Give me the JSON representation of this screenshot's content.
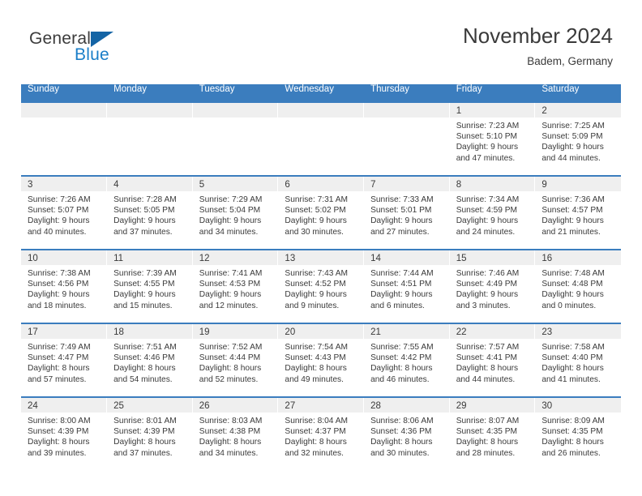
{
  "brand": {
    "name_part1": "General",
    "name_part2": "Blue",
    "accent_color": "#1a7ec8",
    "triangle_color": "#1464a5"
  },
  "header": {
    "month_title": "November 2024",
    "location": "Badem, Germany"
  },
  "theme": {
    "header_blue": "#3b7dbe",
    "day_head_gray": "#efefef",
    "text_color": "#3a3a3a"
  },
  "calendar": {
    "weekday_headers": [
      "Sunday",
      "Monday",
      "Tuesday",
      "Wednesday",
      "Thursday",
      "Friday",
      "Saturday"
    ],
    "weeks": [
      [
        {
          "day": "",
          "lines": []
        },
        {
          "day": "",
          "lines": []
        },
        {
          "day": "",
          "lines": []
        },
        {
          "day": "",
          "lines": []
        },
        {
          "day": "",
          "lines": []
        },
        {
          "day": "1",
          "lines": [
            "Sunrise: 7:23 AM",
            "Sunset: 5:10 PM",
            "Daylight: 9 hours",
            "and 47 minutes."
          ]
        },
        {
          "day": "2",
          "lines": [
            "Sunrise: 7:25 AM",
            "Sunset: 5:09 PM",
            "Daylight: 9 hours",
            "and 44 minutes."
          ]
        }
      ],
      [
        {
          "day": "3",
          "lines": [
            "Sunrise: 7:26 AM",
            "Sunset: 5:07 PM",
            "Daylight: 9 hours",
            "and 40 minutes."
          ]
        },
        {
          "day": "4",
          "lines": [
            "Sunrise: 7:28 AM",
            "Sunset: 5:05 PM",
            "Daylight: 9 hours",
            "and 37 minutes."
          ]
        },
        {
          "day": "5",
          "lines": [
            "Sunrise: 7:29 AM",
            "Sunset: 5:04 PM",
            "Daylight: 9 hours",
            "and 34 minutes."
          ]
        },
        {
          "day": "6",
          "lines": [
            "Sunrise: 7:31 AM",
            "Sunset: 5:02 PM",
            "Daylight: 9 hours",
            "and 30 minutes."
          ]
        },
        {
          "day": "7",
          "lines": [
            "Sunrise: 7:33 AM",
            "Sunset: 5:01 PM",
            "Daylight: 9 hours",
            "and 27 minutes."
          ]
        },
        {
          "day": "8",
          "lines": [
            "Sunrise: 7:34 AM",
            "Sunset: 4:59 PM",
            "Daylight: 9 hours",
            "and 24 minutes."
          ]
        },
        {
          "day": "9",
          "lines": [
            "Sunrise: 7:36 AM",
            "Sunset: 4:57 PM",
            "Daylight: 9 hours",
            "and 21 minutes."
          ]
        }
      ],
      [
        {
          "day": "10",
          "lines": [
            "Sunrise: 7:38 AM",
            "Sunset: 4:56 PM",
            "Daylight: 9 hours",
            "and 18 minutes."
          ]
        },
        {
          "day": "11",
          "lines": [
            "Sunrise: 7:39 AM",
            "Sunset: 4:55 PM",
            "Daylight: 9 hours",
            "and 15 minutes."
          ]
        },
        {
          "day": "12",
          "lines": [
            "Sunrise: 7:41 AM",
            "Sunset: 4:53 PM",
            "Daylight: 9 hours",
            "and 12 minutes."
          ]
        },
        {
          "day": "13",
          "lines": [
            "Sunrise: 7:43 AM",
            "Sunset: 4:52 PM",
            "Daylight: 9 hours",
            "and 9 minutes."
          ]
        },
        {
          "day": "14",
          "lines": [
            "Sunrise: 7:44 AM",
            "Sunset: 4:51 PM",
            "Daylight: 9 hours",
            "and 6 minutes."
          ]
        },
        {
          "day": "15",
          "lines": [
            "Sunrise: 7:46 AM",
            "Sunset: 4:49 PM",
            "Daylight: 9 hours",
            "and 3 minutes."
          ]
        },
        {
          "day": "16",
          "lines": [
            "Sunrise: 7:48 AM",
            "Sunset: 4:48 PM",
            "Daylight: 9 hours",
            "and 0 minutes."
          ]
        }
      ],
      [
        {
          "day": "17",
          "lines": [
            "Sunrise: 7:49 AM",
            "Sunset: 4:47 PM",
            "Daylight: 8 hours",
            "and 57 minutes."
          ]
        },
        {
          "day": "18",
          "lines": [
            "Sunrise: 7:51 AM",
            "Sunset: 4:46 PM",
            "Daylight: 8 hours",
            "and 54 minutes."
          ]
        },
        {
          "day": "19",
          "lines": [
            "Sunrise: 7:52 AM",
            "Sunset: 4:44 PM",
            "Daylight: 8 hours",
            "and 52 minutes."
          ]
        },
        {
          "day": "20",
          "lines": [
            "Sunrise: 7:54 AM",
            "Sunset: 4:43 PM",
            "Daylight: 8 hours",
            "and 49 minutes."
          ]
        },
        {
          "day": "21",
          "lines": [
            "Sunrise: 7:55 AM",
            "Sunset: 4:42 PM",
            "Daylight: 8 hours",
            "and 46 minutes."
          ]
        },
        {
          "day": "22",
          "lines": [
            "Sunrise: 7:57 AM",
            "Sunset: 4:41 PM",
            "Daylight: 8 hours",
            "and 44 minutes."
          ]
        },
        {
          "day": "23",
          "lines": [
            "Sunrise: 7:58 AM",
            "Sunset: 4:40 PM",
            "Daylight: 8 hours",
            "and 41 minutes."
          ]
        }
      ],
      [
        {
          "day": "24",
          "lines": [
            "Sunrise: 8:00 AM",
            "Sunset: 4:39 PM",
            "Daylight: 8 hours",
            "and 39 minutes."
          ]
        },
        {
          "day": "25",
          "lines": [
            "Sunrise: 8:01 AM",
            "Sunset: 4:39 PM",
            "Daylight: 8 hours",
            "and 37 minutes."
          ]
        },
        {
          "day": "26",
          "lines": [
            "Sunrise: 8:03 AM",
            "Sunset: 4:38 PM",
            "Daylight: 8 hours",
            "and 34 minutes."
          ]
        },
        {
          "day": "27",
          "lines": [
            "Sunrise: 8:04 AM",
            "Sunset: 4:37 PM",
            "Daylight: 8 hours",
            "and 32 minutes."
          ]
        },
        {
          "day": "28",
          "lines": [
            "Sunrise: 8:06 AM",
            "Sunset: 4:36 PM",
            "Daylight: 8 hours",
            "and 30 minutes."
          ]
        },
        {
          "day": "29",
          "lines": [
            "Sunrise: 8:07 AM",
            "Sunset: 4:35 PM",
            "Daylight: 8 hours",
            "and 28 minutes."
          ]
        },
        {
          "day": "30",
          "lines": [
            "Sunrise: 8:09 AM",
            "Sunset: 4:35 PM",
            "Daylight: 8 hours",
            "and 26 minutes."
          ]
        }
      ]
    ]
  }
}
